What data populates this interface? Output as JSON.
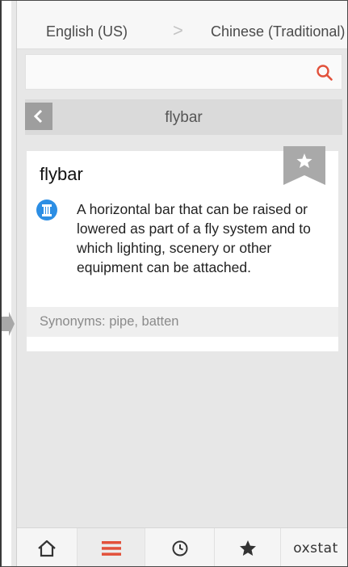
{
  "languages": {
    "from": "English (US)",
    "separator": ">",
    "to": "Chinese (Traditional)"
  },
  "search": {
    "value": "",
    "placeholder": "",
    "icon": "search-icon"
  },
  "header": {
    "word": "flybar",
    "back_icon": "chevron-left-icon"
  },
  "entry": {
    "word": "flybar",
    "definition": "A horizontal bar that can be raised or lowered as part of a fly system and to which lighting, scenery or other equipment can be attached.",
    "synonyms": "Synonyms: pipe, batten",
    "bookmark_icon": "star-bookmark-icon",
    "definition_icon": "pillar-icon"
  },
  "tabs": [
    {
      "name": "home",
      "icon": "home-icon"
    },
    {
      "name": "list",
      "icon": "menu-icon",
      "active": true
    },
    {
      "name": "history",
      "icon": "clock-icon"
    },
    {
      "name": "favorites",
      "icon": "star-icon"
    },
    {
      "name": "brand",
      "label": "oxstat"
    }
  ],
  "colors": {
    "accent": "#e2513b",
    "definition_icon": "#2c8ee4",
    "ribbon": "#a9a9a9"
  }
}
